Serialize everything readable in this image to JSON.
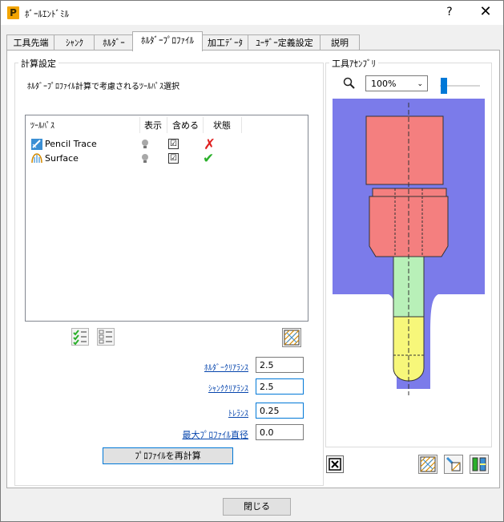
{
  "window": {
    "title": "ﾎﾞｰﾙｴﾝﾄﾞﾐﾙ",
    "app_icon_letter": "P",
    "help_label": "?",
    "close_glyph": "✕"
  },
  "tabs": [
    {
      "label": "工具先端"
    },
    {
      "label": "ｼｬﾝｸ"
    },
    {
      "label": "ﾎﾙﾀﾞｰ"
    },
    {
      "label": "ﾎﾙﾀﾞｰﾌﾟﾛﾌｧｲﾙ",
      "active": true
    },
    {
      "label": "加工ﾃﾞｰﾀ"
    },
    {
      "label": "ﾕｰｻﾞｰ定義設定"
    },
    {
      "label": "説明"
    }
  ],
  "calc": {
    "group_title": "計算設定",
    "description": "ﾎﾙﾀﾞｰﾌﾟﾛﾌｧｲﾙ計算で考慮されるﾂｰﾙﾊﾟｽ選択",
    "columns": {
      "toolpath": "ﾂｰﾙﾊﾟｽ",
      "show": "表示",
      "include": "含める",
      "status": "状態"
    },
    "rows": [
      {
        "name": "Pencil Trace",
        "icon": "pencil-trace-toolpath-icon",
        "show": "lightbulb-icon",
        "include": "☑",
        "status": "✗",
        "status_color": "#e02020"
      },
      {
        "name": "Surface",
        "icon": "surface-toolpath-icon",
        "show": "lightbulb-icon",
        "include": "☑",
        "status": "✔",
        "status_color": "#2bb02b"
      }
    ],
    "fields": {
      "holder_clearance": {
        "label": "ﾎﾙﾀﾞｰｸﾘｱﾗﾝｽ",
        "value": "2.5"
      },
      "shank_clearance": {
        "label": "ｼｬﾝｸｸﾘｱﾗﾝｽ",
        "value": "2.5"
      },
      "tolerance": {
        "label": "ﾄﾚﾗﾝｽ",
        "value": "0.25"
      },
      "max_profile_diameter": {
        "label": "最大ﾌﾟﾛﾌｧｲﾙ直径",
        "value": "0.0"
      }
    },
    "recalc_button": "ﾌﾟﾛﾌｧｲﾙを再計算"
  },
  "assembly": {
    "group_title": "工具ｱｾﾝﾌﾞﾘ",
    "zoom_value": "100%",
    "zoom_slider_fraction": 0.0,
    "colors": {
      "background": "#7b7bea",
      "holder": "#f47f7f",
      "shank": "#b8f0b8",
      "tip": "#f7f77a"
    }
  },
  "footer": {
    "close_button": "閉じる"
  }
}
